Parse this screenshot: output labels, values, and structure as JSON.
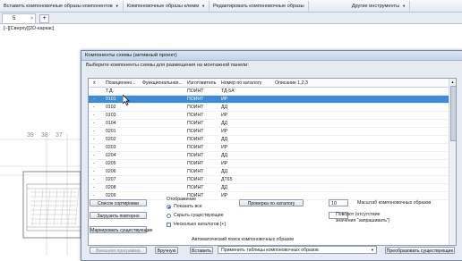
{
  "ribbon": {
    "items": [
      {
        "label": "Вставить компоновочные образы компонентов",
        "dropdown": true
      },
      {
        "label": "Компоновочные образы клемм",
        "dropdown": true
      },
      {
        "label": "Редактировать компоновочные образы",
        "dropdown": false
      },
      {
        "label": "Другие инструменты",
        "dropdown": true
      }
    ]
  },
  "tabs": {
    "doc_tab": "5",
    "add_symbol": "+",
    "close_symbol": "×"
  },
  "viewport": {
    "label": "[–][Сверху][2D-каркас]"
  },
  "drawing": {
    "dims": [
      "39",
      "38",
      "37"
    ]
  },
  "dialog": {
    "title": "Компоненты схемы (активный проект)",
    "prompt": "Выберите компоненты схемы для размещения на монтажной панели:",
    "columns": [
      "x",
      "Позиционно...",
      "Функциональная...",
      "Изготовитель",
      "Номер по каталогу",
      "Описание 1,2,3"
    ],
    "rows": [
      {
        "x": "",
        "pos": "Т.Д.",
        "mfr": "ПОИНТ",
        "cat": "ТД-5А",
        "selected": false
      },
      {
        "x": "-",
        "pos": "0101",
        "mfr": "ПОИНТ",
        "cat": "ИР",
        "selected": true
      },
      {
        "x": "-",
        "pos": "0102",
        "mfr": "ПОИНТ",
        "cat": "ДД",
        "selected": false
      },
      {
        "x": "-",
        "pos": "0103",
        "mfr": "ПОИНТ",
        "cat": "ИР",
        "selected": false
      },
      {
        "x": "-",
        "pos": "0104",
        "mfr": "ПОИНТ",
        "cat": "ДД",
        "selected": false
      },
      {
        "x": "-",
        "pos": "0201",
        "mfr": "ПОИНТ",
        "cat": "ИР",
        "selected": false
      },
      {
        "x": "-",
        "pos": "0202",
        "mfr": "ПОИНТ",
        "cat": "ДД",
        "selected": false
      },
      {
        "x": "-",
        "pos": "0203",
        "mfr": "ПОИНТ",
        "cat": "ИР",
        "selected": false
      },
      {
        "x": "-",
        "pos": "0204",
        "mfr": "ПОИНТ",
        "cat": "ДД",
        "selected": false
      },
      {
        "x": "-",
        "pos": "0205",
        "mfr": "ПОИНТ",
        "cat": "ИР",
        "selected": false
      },
      {
        "x": "-",
        "pos": "0206",
        "mfr": "ПОИНТ",
        "cat": "ДД",
        "selected": false
      },
      {
        "x": "-",
        "pos": "0207",
        "mfr": "ПОИНТ",
        "cat": "ДТ65",
        "selected": false
      },
      {
        "x": "-",
        "pos": "0208",
        "mfr": "ПОИНТ",
        "cat": "ДД",
        "selected": false
      },
      {
        "x": "-",
        "pos": "0209",
        "mfr": "ПОИНТ",
        "cat": "ИР",
        "selected": false
      }
    ],
    "buttons": {
      "sort_list": "Список сортировки",
      "reload": "Загрузить повторно",
      "mark_existing": "Маркировать существующие",
      "check_catalog": "Проверка по каталогу",
      "external_program": "Внешняя программа",
      "manual": "Вручную",
      "insert": "Вставить",
      "convert_existing": "Преобразовать существующие"
    },
    "display": {
      "group_label": "Отображение",
      "show_all": "Показать все",
      "hide_existing": "Скрыть существующие",
      "multiple_catalogs": "Несколько каталогов [+]",
      "selected": "show_all"
    },
    "scale": {
      "value": "10",
      "label": "Масштаб компоновочных образов"
    },
    "rotation": {
      "label_line1": "Поворот (отсутствие",
      "label_line2": "значения \"запрашивать\")"
    },
    "auto_search_label": "Автоматический поиск компоновочных образов",
    "apply_select": {
      "value": "Применить таблицы компоновочных образов"
    }
  }
}
